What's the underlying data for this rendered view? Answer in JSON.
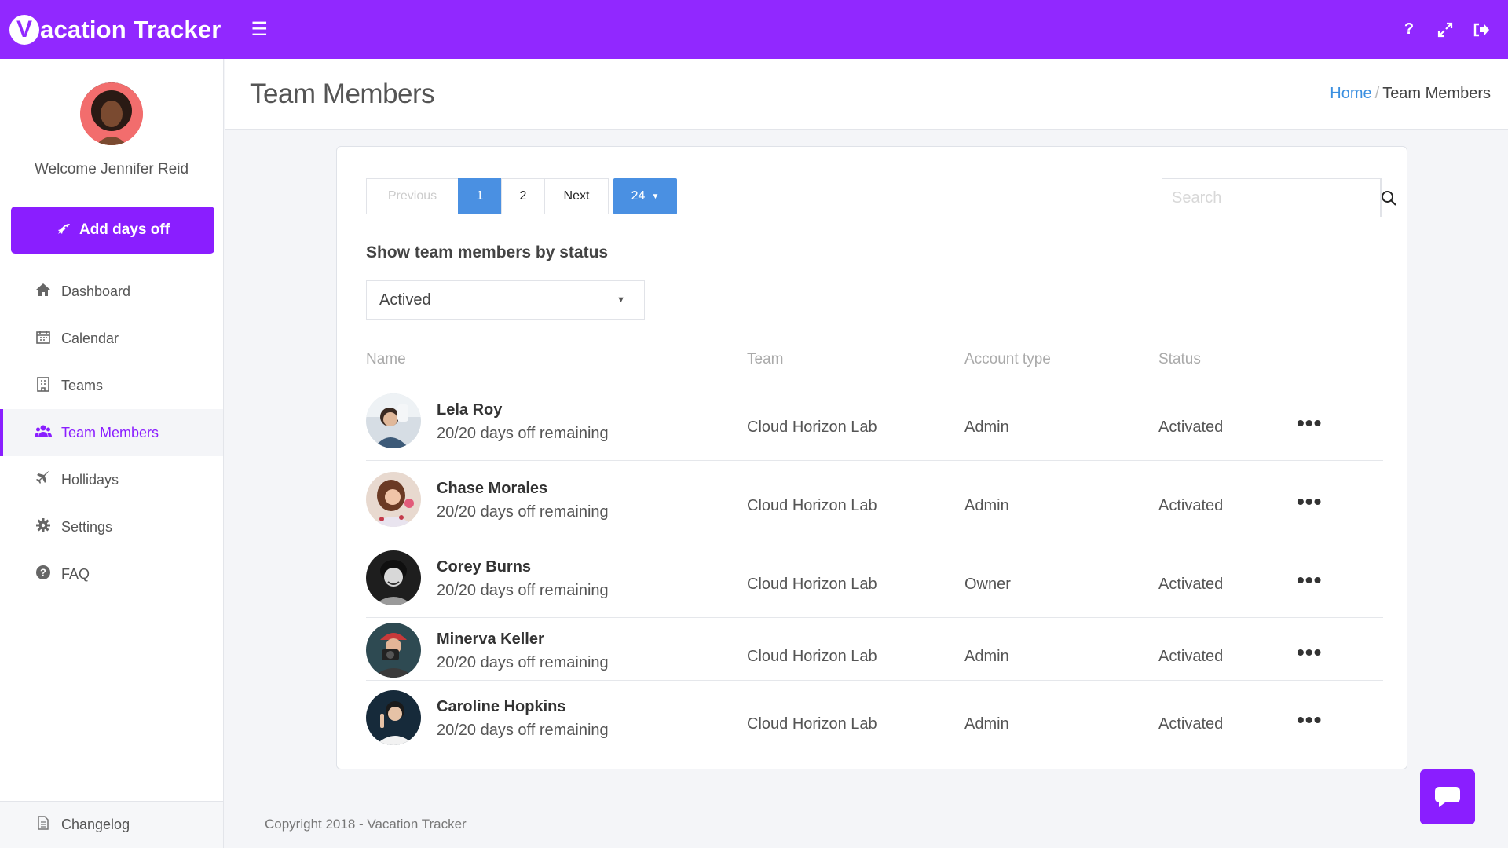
{
  "app": {
    "logo_mark": "V",
    "logo_text": "acation Tracker"
  },
  "topbar": {
    "menu_icon": "☰",
    "help_icon": "?",
    "fullscreen_icon": "⤢",
    "logout_icon": "⇥"
  },
  "sidebar": {
    "welcome": "Welcome Jennifer Reid",
    "add_button_label": "Add days off",
    "items": [
      {
        "label": "Dashboard",
        "icon": "home-icon"
      },
      {
        "label": "Calendar",
        "icon": "calendar-icon"
      },
      {
        "label": "Teams",
        "icon": "building-icon"
      },
      {
        "label": "Team Members",
        "icon": "users-icon",
        "active": true
      },
      {
        "label": "Hollidays",
        "icon": "plane-icon"
      },
      {
        "label": "Settings",
        "icon": "gear-icon"
      },
      {
        "label": "FAQ",
        "icon": "question-icon"
      }
    ],
    "changelog": "Changelog"
  },
  "header": {
    "title": "Team Members",
    "breadcrumb_home": "Home",
    "breadcrumb_sep": "/",
    "breadcrumb_current": "Team Members"
  },
  "pagination": {
    "previous": "Previous",
    "page1": "1",
    "page2": "2",
    "next": "Next",
    "page_size": "24"
  },
  "search": {
    "placeholder": "Search",
    "value": ""
  },
  "filter": {
    "label": "Show team members by status",
    "selected": "Actived"
  },
  "table": {
    "headers": {
      "name": "Name",
      "team": "Team",
      "account_type": "Account type",
      "status": "Status"
    },
    "rows": [
      {
        "name": "Lela Roy",
        "days": "20/20 days off remaining",
        "team": "Cloud Horizon Lab",
        "account_type": "Admin",
        "status": "Activated",
        "more": "•••"
      },
      {
        "name": "Chase Morales",
        "days": "20/20 days off remaining",
        "team": "Cloud Horizon Lab",
        "account_type": "Admin",
        "status": "Activated",
        "more": "•••"
      },
      {
        "name": "Corey Burns",
        "days": "20/20 days off remaining",
        "team": "Cloud Horizon Lab",
        "account_type": "Owner",
        "status": "Activated",
        "more": "•••"
      },
      {
        "name": "Minerva Keller",
        "days": "20/20 days off remaining",
        "team": "Cloud Horizon Lab",
        "account_type": "Admin",
        "status": "Activated",
        "more": "•••"
      },
      {
        "name": "Caroline Hopkins",
        "days": "20/20 days off remaining",
        "team": "Cloud Horizon Lab",
        "account_type": "Admin",
        "status": "Activated",
        "more": "•••"
      }
    ]
  },
  "footer": {
    "copyright": "Copyright 2018 - Vacation Tracker"
  },
  "colors": {
    "brand": "#9128ff",
    "accent_blue": "#4a90e2"
  }
}
